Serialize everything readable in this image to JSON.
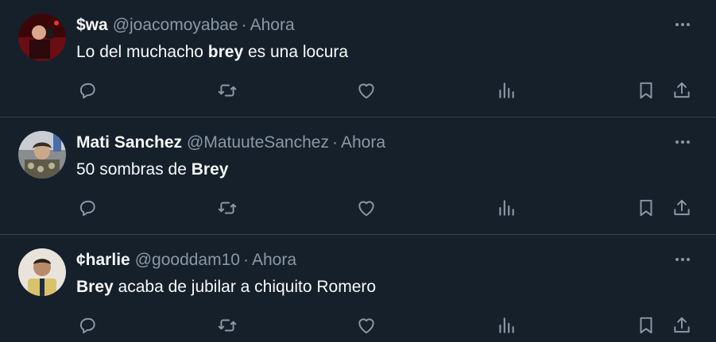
{
  "colors": {
    "background": "#15202b",
    "text_primary": "#f7f9f9",
    "text_secondary": "#8b98a5",
    "divider": "#38444d"
  },
  "separator": "·",
  "icons": {
    "more": "more-dots-icon",
    "reply": "reply-icon",
    "retweet": "retweet-icon",
    "like": "heart-icon",
    "views": "views-bar-chart-icon",
    "bookmark": "bookmark-icon",
    "share": "share-icon"
  },
  "tweets": [
    {
      "display_name": "$wa",
      "handle": "@joacomoyabae",
      "time": "Ahora",
      "text_before": "Lo del muchacho ",
      "text_bold": "brey",
      "text_after": " es una locura"
    },
    {
      "display_name": "Mati Sanchez",
      "handle": "@MatuuteSanchez",
      "time": "Ahora",
      "text_before": "50 sombras de ",
      "text_bold": "Brey",
      "text_after": ""
    },
    {
      "display_name": "¢harlie",
      "handle": "@gooddam10",
      "time": "Ahora",
      "text_before": "",
      "text_bold": "Brey",
      "text_after": " acaba de jubilar a chiquito Romero"
    }
  ]
}
